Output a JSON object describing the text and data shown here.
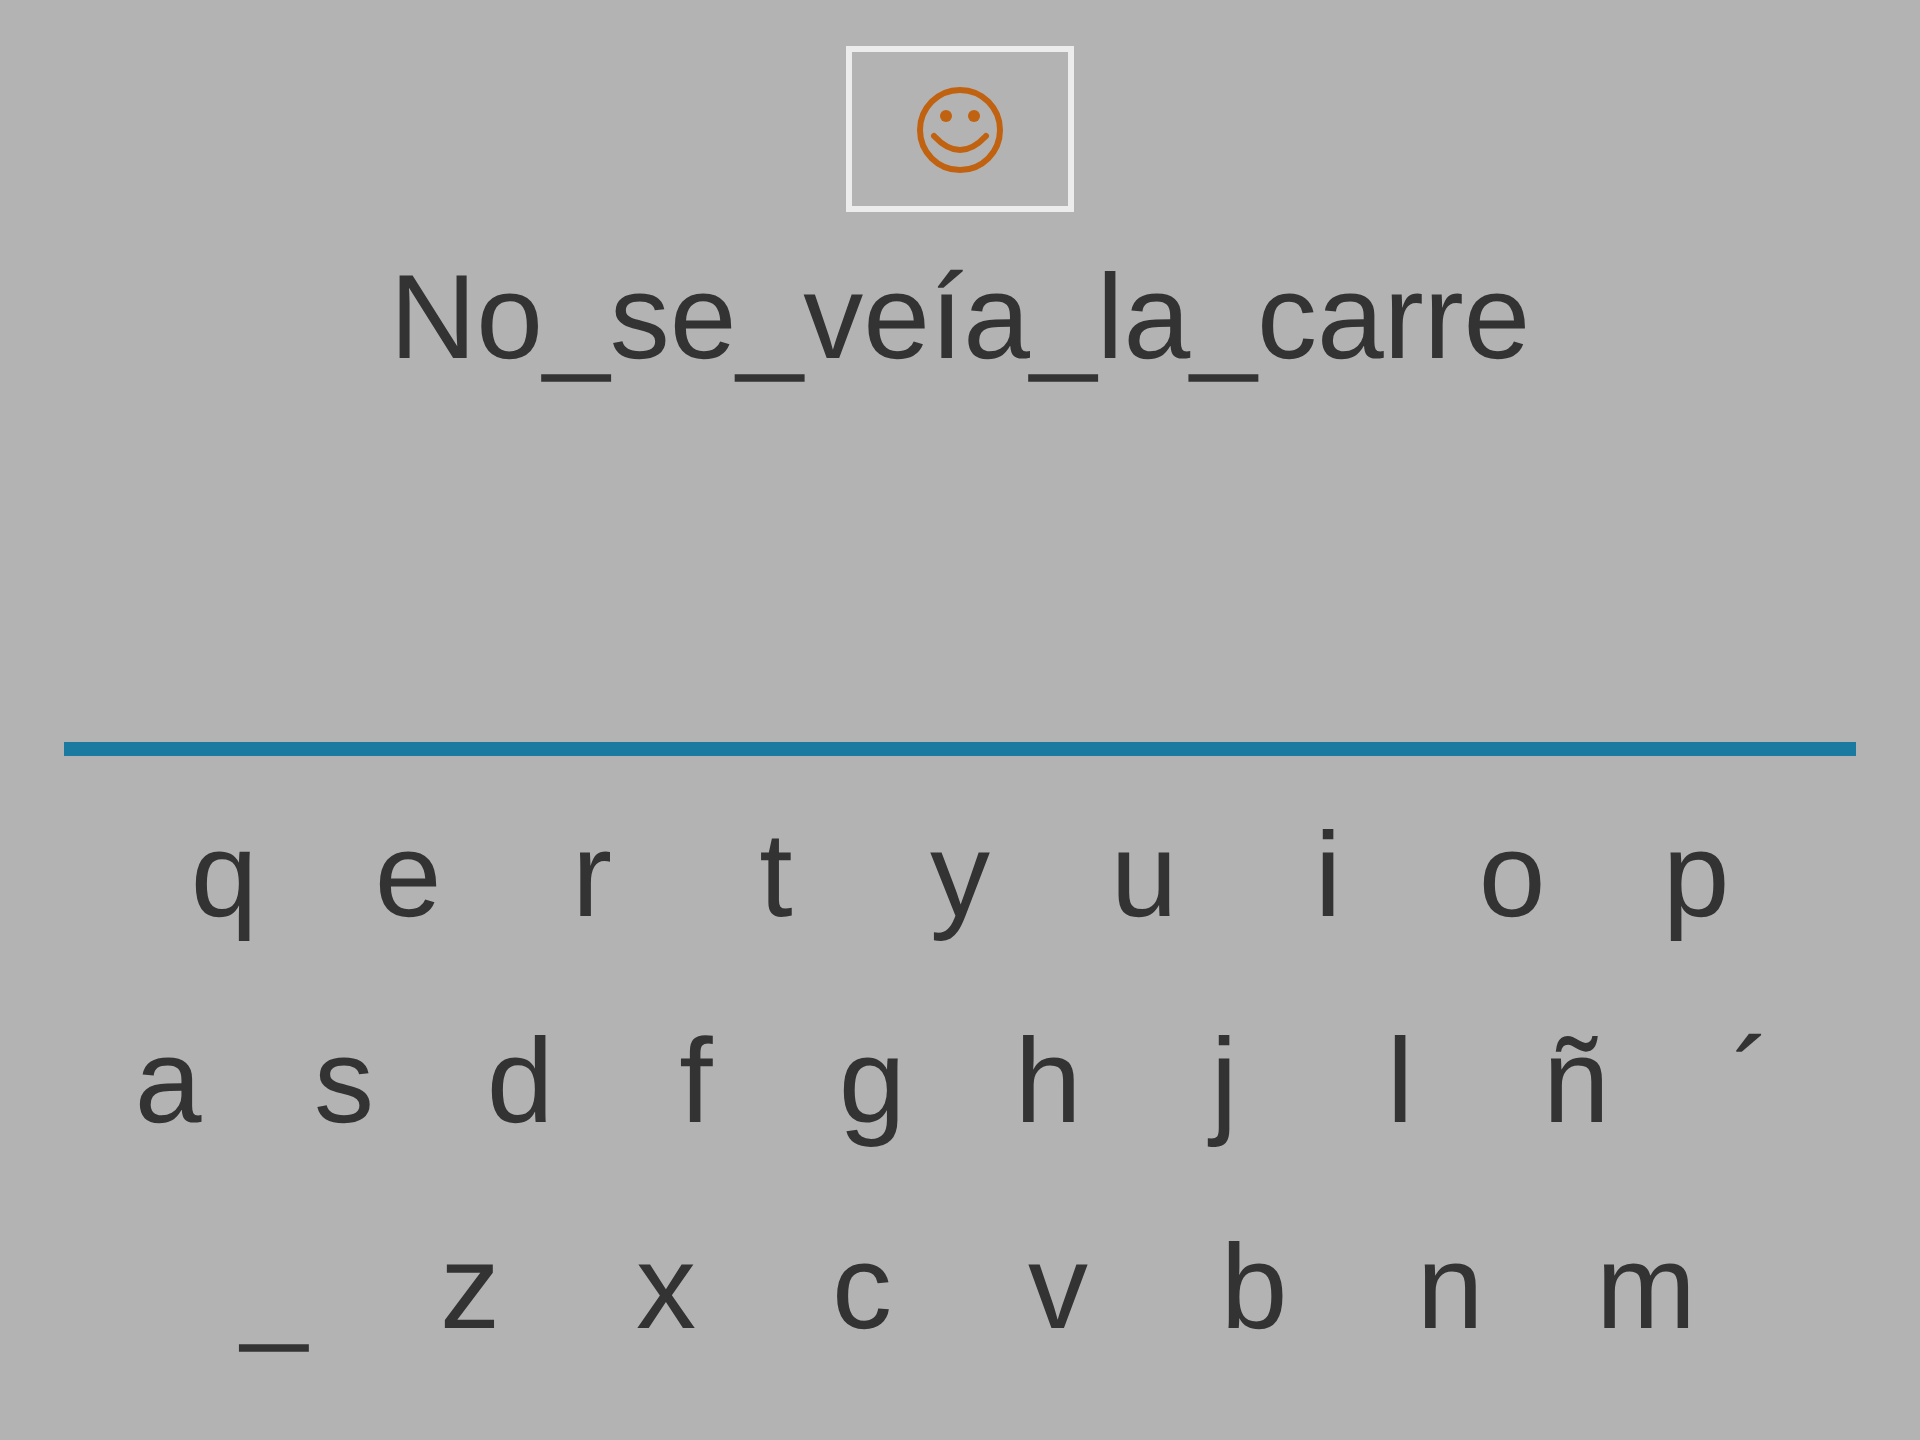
{
  "phrase": "No_se_veía_la_carre",
  "keyboard": {
    "rows": [
      [
        "q",
        "e",
        "r",
        "t",
        "y",
        "u",
        "i",
        "o",
        "p"
      ],
      [
        "a",
        "s",
        "d",
        "f",
        "g",
        "h",
        "j",
        "l",
        "ñ",
        "´"
      ],
      [
        "_",
        "z",
        "x",
        "c",
        "v",
        "b",
        "n",
        "m"
      ]
    ]
  }
}
